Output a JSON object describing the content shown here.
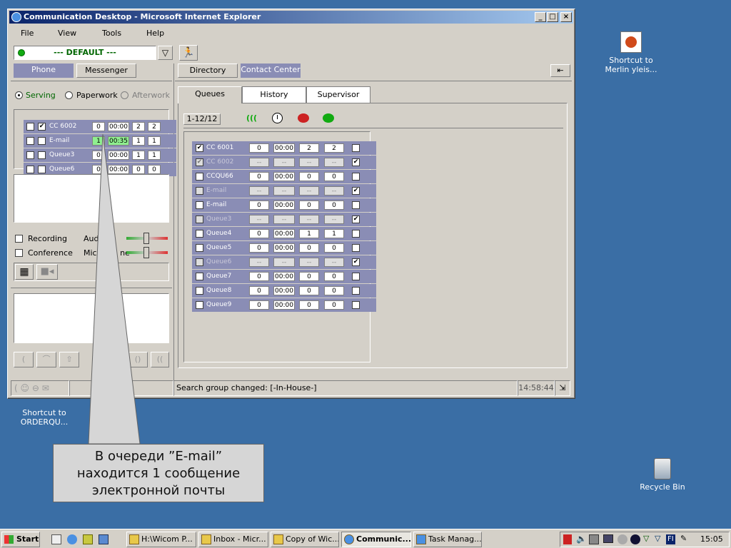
{
  "window": {
    "title": "Communication Desktop - Microsoft Internet Explorer",
    "minimize": "_",
    "maximize": "□",
    "close": "×"
  },
  "menu": [
    "File",
    "View",
    "Tools",
    "Help"
  ],
  "profile": {
    "value": "--- DEFAULT ---"
  },
  "left_tabs": [
    "Phone",
    "Messenger"
  ],
  "status_options": {
    "serving": "Serving",
    "paperwork": "Paperwork",
    "afterwork": "Afterwork"
  },
  "left_queues": [
    {
      "name": "CC 6002",
      "checked": true,
      "a": "0",
      "t": "00:00",
      "b": "2",
      "c": "2",
      "highlight": false
    },
    {
      "name": "E-mail",
      "checked": false,
      "a": "1",
      "t": "00:35",
      "b": "1",
      "c": "1",
      "highlight": true
    },
    {
      "name": "Queue3",
      "checked": false,
      "a": "0",
      "t": "00:00",
      "b": "1",
      "c": "1",
      "highlight": false
    },
    {
      "name": "Queue6",
      "checked": false,
      "a": "0",
      "t": "00:00",
      "b": "0",
      "c": "0",
      "highlight": false
    }
  ],
  "options": {
    "recording": "Recording",
    "conference": "Conference",
    "audio": "Aud",
    "microphone": "Micr        ne"
  },
  "right_tabs": [
    "Directory",
    "Contact Center"
  ],
  "subtabs": [
    "Queues",
    "History",
    "Supervisor"
  ],
  "range": "1-12/12",
  "queues": [
    {
      "name": "CC 6001",
      "a": "0",
      "t": "00:00",
      "b": "2",
      "c": "2",
      "sel": true,
      "dis": false,
      "flag": false
    },
    {
      "name": "CC 6002",
      "a": "--",
      "t": "--",
      "b": "--",
      "c": "--",
      "sel": true,
      "dis": true,
      "flag": true
    },
    {
      "name": "CCQU66",
      "a": "0",
      "t": "00:00",
      "b": "0",
      "c": "0",
      "sel": false,
      "dis": false,
      "flag": false
    },
    {
      "name": "E-mail",
      "a": "--",
      "t": "--",
      "b": "--",
      "c": "--",
      "sel": false,
      "dis": true,
      "flag": true
    },
    {
      "name": "E-mail",
      "a": "0",
      "t": "00:00",
      "b": "0",
      "c": "0",
      "sel": false,
      "dis": false,
      "flag": false
    },
    {
      "name": "Queue3",
      "a": "--",
      "t": "--",
      "b": "--",
      "c": "--",
      "sel": false,
      "dis": true,
      "flag": true
    },
    {
      "name": "Queue4",
      "a": "0",
      "t": "00:00",
      "b": "1",
      "c": "1",
      "sel": false,
      "dis": false,
      "flag": false
    },
    {
      "name": "Queue5",
      "a": "0",
      "t": "00:00",
      "b": "0",
      "c": "0",
      "sel": false,
      "dis": false,
      "flag": false
    },
    {
      "name": "Queue6",
      "a": "--",
      "t": "--",
      "b": "--",
      "c": "--",
      "sel": false,
      "dis": true,
      "flag": true
    },
    {
      "name": "Queue7",
      "a": "0",
      "t": "00:00",
      "b": "0",
      "c": "0",
      "sel": false,
      "dis": false,
      "flag": false
    },
    {
      "name": "Queue8",
      "a": "0",
      "t": "00:00",
      "b": "0",
      "c": "0",
      "sel": false,
      "dis": false,
      "flag": false
    },
    {
      "name": "Queue9",
      "a": "0",
      "t": "00:00",
      "b": "0",
      "c": "0",
      "sel": false,
      "dis": false,
      "flag": false
    }
  ],
  "statusbar": {
    "message": "Search group changed: [-In-House-]",
    "time": "14:58:44"
  },
  "callout": {
    "line1": "В очереди ”E-mail”",
    "line2": "находится 1 сообщение",
    "line3": "электронной почты"
  },
  "desktop": {
    "shortcut1": "Shortcut to Merlin yleis...",
    "shortcut2": "Shortcut to ORDERQU...",
    "recycle": "Recycle Bin"
  },
  "taskbar": {
    "start": "Start",
    "tasks": [
      "H:\\Wicom P...",
      "Inbox - Micr...",
      "Copy of Wic...",
      "Communic...",
      "Task Manag..."
    ],
    "lang": "FI",
    "clock": "15:05"
  },
  "colors": {
    "queue_row": "#8a8db5",
    "highlight": "#8fef8f",
    "title_start": "#0a246a",
    "desktop": "#3a6ea5"
  }
}
